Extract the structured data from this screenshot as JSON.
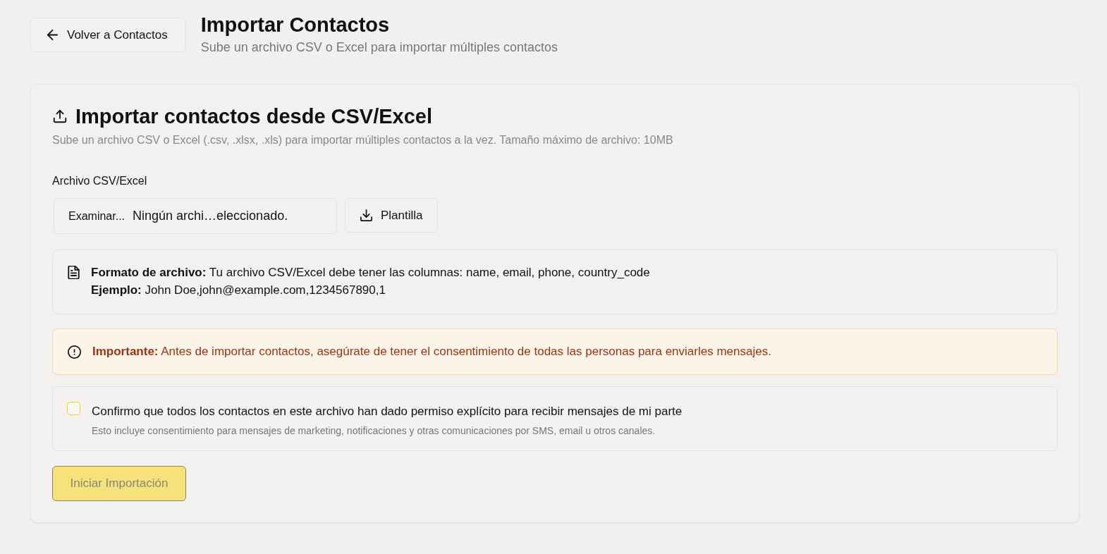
{
  "header": {
    "back_button": "Volver a Contactos",
    "title": "Importar Contactos",
    "subtitle": "Sube un archivo CSV o Excel para importar múltiples contactos"
  },
  "card": {
    "title": "Importar contactos desde CSV/Excel",
    "description": "Sube un archivo CSV o Excel (.csv, .xlsx, .xls) para importar múltiples contactos a la vez. Tamaño máximo de archivo: 10MB",
    "file_field": {
      "label": "Archivo CSV/Excel",
      "browse_button": "Examinar...",
      "value": "Ningún archi…eleccionado."
    },
    "template_button": "Plantilla",
    "format_note": {
      "lines": [
        "**Formato de archivo:** Tu archivo CSV/Excel debe tener las columnas: name, email, phone, country_code",
        "**Ejemplo:** John Doe,john@example.com,1234567890,1"
      ]
    },
    "alert": {
      "kind": "warning",
      "text": "**Importante:** Antes de importar contactos, asegúrate de tener el consentimiento de todas las personas para enviarles mensajes."
    },
    "consent": {
      "checked": false,
      "label": "Confirmo que todos los contactos en este archivo han dado permiso explícito para recibir mensajes de mi parte",
      "hint": "Esto incluye consentimiento para mensajes de marketing, notificaciones y otras comunicaciones por SMS, email u otros canales."
    },
    "submit": {
      "label": "Iniciar Importación",
      "disabled": true
    }
  }
}
